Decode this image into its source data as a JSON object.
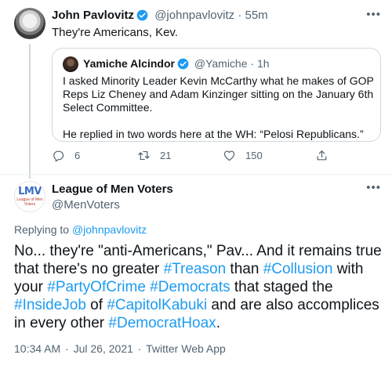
{
  "tweet": {
    "author_name": "John Pavlovitz",
    "author_handle": "@johnpavlovitz",
    "time": "55m",
    "text": "They're Americans, Kev.",
    "quote": {
      "author_name": "Yamiche Alcindor",
      "author_handle": "@Yamiche",
      "time": "1h",
      "paragraph1": "I asked Minority Leader Kevin McCarthy what he makes of GOP Reps Liz Cheney and Adam Kinzinger sitting on the January 6th Select Committee.",
      "paragraph2": "He replied in two words here at the WH: “Pelosi Republicans.”"
    },
    "actions": {
      "replies": "6",
      "retweets": "21",
      "likes": "150"
    }
  },
  "reply": {
    "avatar_text": "LMV",
    "avatar_subtext": "League of Men Voters",
    "author_name": "League of Men Voters",
    "author_handle": "@MenVoters",
    "replying_prefix": "Replying to",
    "replying_to": "@johnpavlovitz",
    "body": {
      "p1": "No... they're \"anti-Americans,\" Pav... And it remains true that there's no greater ",
      "h_treason": "#Treason",
      "p2": " than ",
      "h_collusion": "#Collusion",
      "p3": " with your ",
      "h_party": "#PartyOfCrime",
      "p4": " ",
      "h_democrats": "#Democrats",
      "p5": " that staged the ",
      "h_insidejob": "#InsideJob",
      "p6": " of ",
      "h_capitol": "#CapitolKabuki",
      "p7": " and are also accomplices in every other ",
      "h_hoax": "#DemocratHoax",
      "p8": "."
    },
    "time": "10:34 AM",
    "date": "Jul 26, 2021",
    "source": "Twitter Web App"
  },
  "colors": {
    "accent": "#1d9bf0",
    "muted": "#536471",
    "border": "#cfd9de"
  }
}
